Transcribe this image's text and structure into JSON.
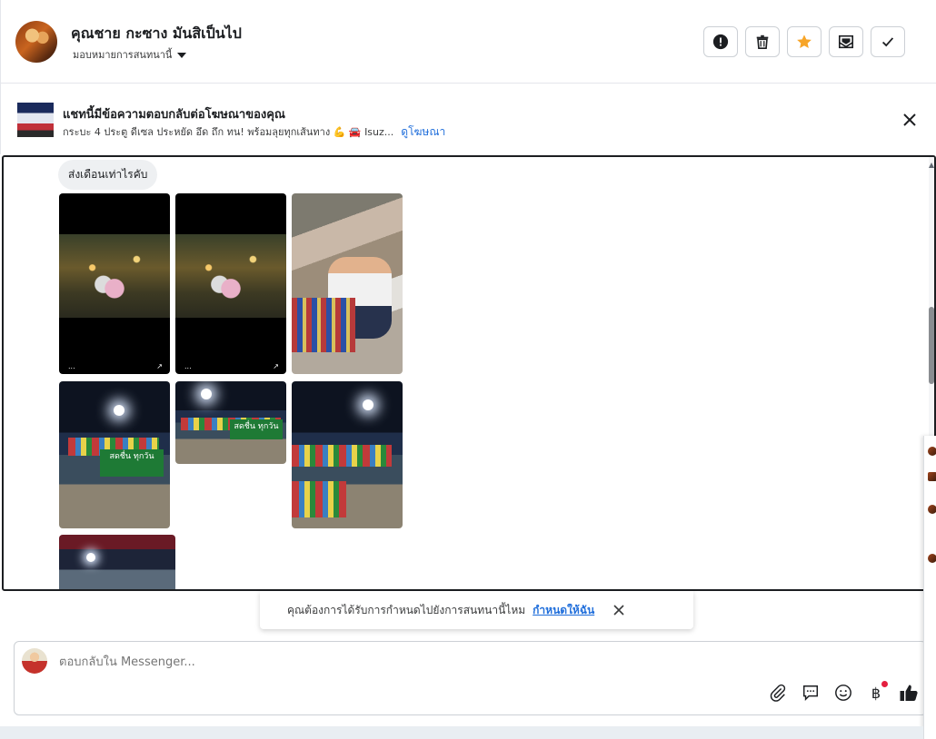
{
  "header": {
    "contact_name": "คุณชาย กะซาง มันสิเป็นไป",
    "assign_label": "มอบหมายการสนทนานี้",
    "actions": [
      {
        "icon": "alert-icon"
      },
      {
        "icon": "trash-icon"
      },
      {
        "icon": "star-icon",
        "color": "#f7a528"
      },
      {
        "icon": "mark-unread-icon"
      },
      {
        "icon": "check-icon"
      }
    ]
  },
  "ad_banner": {
    "title": "แชทนี้มีข้อความตอบกลับต่อโฆษณาของคุณ",
    "subtitle": "กระบะ 4 ประตู ดีเซล ประหยัด อึด ถึก ทน! พร้อมลุยทุกเส้นทาง 💪 🚘 Isuz...",
    "link": "ดูโฆษณา"
  },
  "thread": {
    "message": "ส่งเดือนเท่าไรคับ",
    "photos": [
      {
        "type": "photo",
        "caption_left": "...",
        "caption_right": "↗"
      },
      {
        "type": "photo",
        "caption_left": "...",
        "caption_right": "↗"
      },
      {
        "type": "photo"
      },
      {
        "type": "photo",
        "sign": "สดชื่น ทุกวัน"
      },
      {
        "type": "photo",
        "sign": "สดชื่น ทุกวัน"
      },
      {
        "type": "photo"
      },
      {
        "type": "photo"
      }
    ]
  },
  "reminder": {
    "text": "คุณต้องการได้รับการกำหนดไปยังการสนทนานี้ไหม",
    "link": "กำหนดให้ฉัน"
  },
  "composer": {
    "placeholder": "ตอบกลับใน Messenger...",
    "tools": [
      "paperclip-icon",
      "saved-reply-icon",
      "emoji-icon",
      "baht-payment-icon",
      "thumbs-up-icon"
    ],
    "baht_symbol": "฿"
  },
  "colors": {
    "link": "#216fdb",
    "star": "#f7a528",
    "notification_dot": "#e41e3f"
  }
}
